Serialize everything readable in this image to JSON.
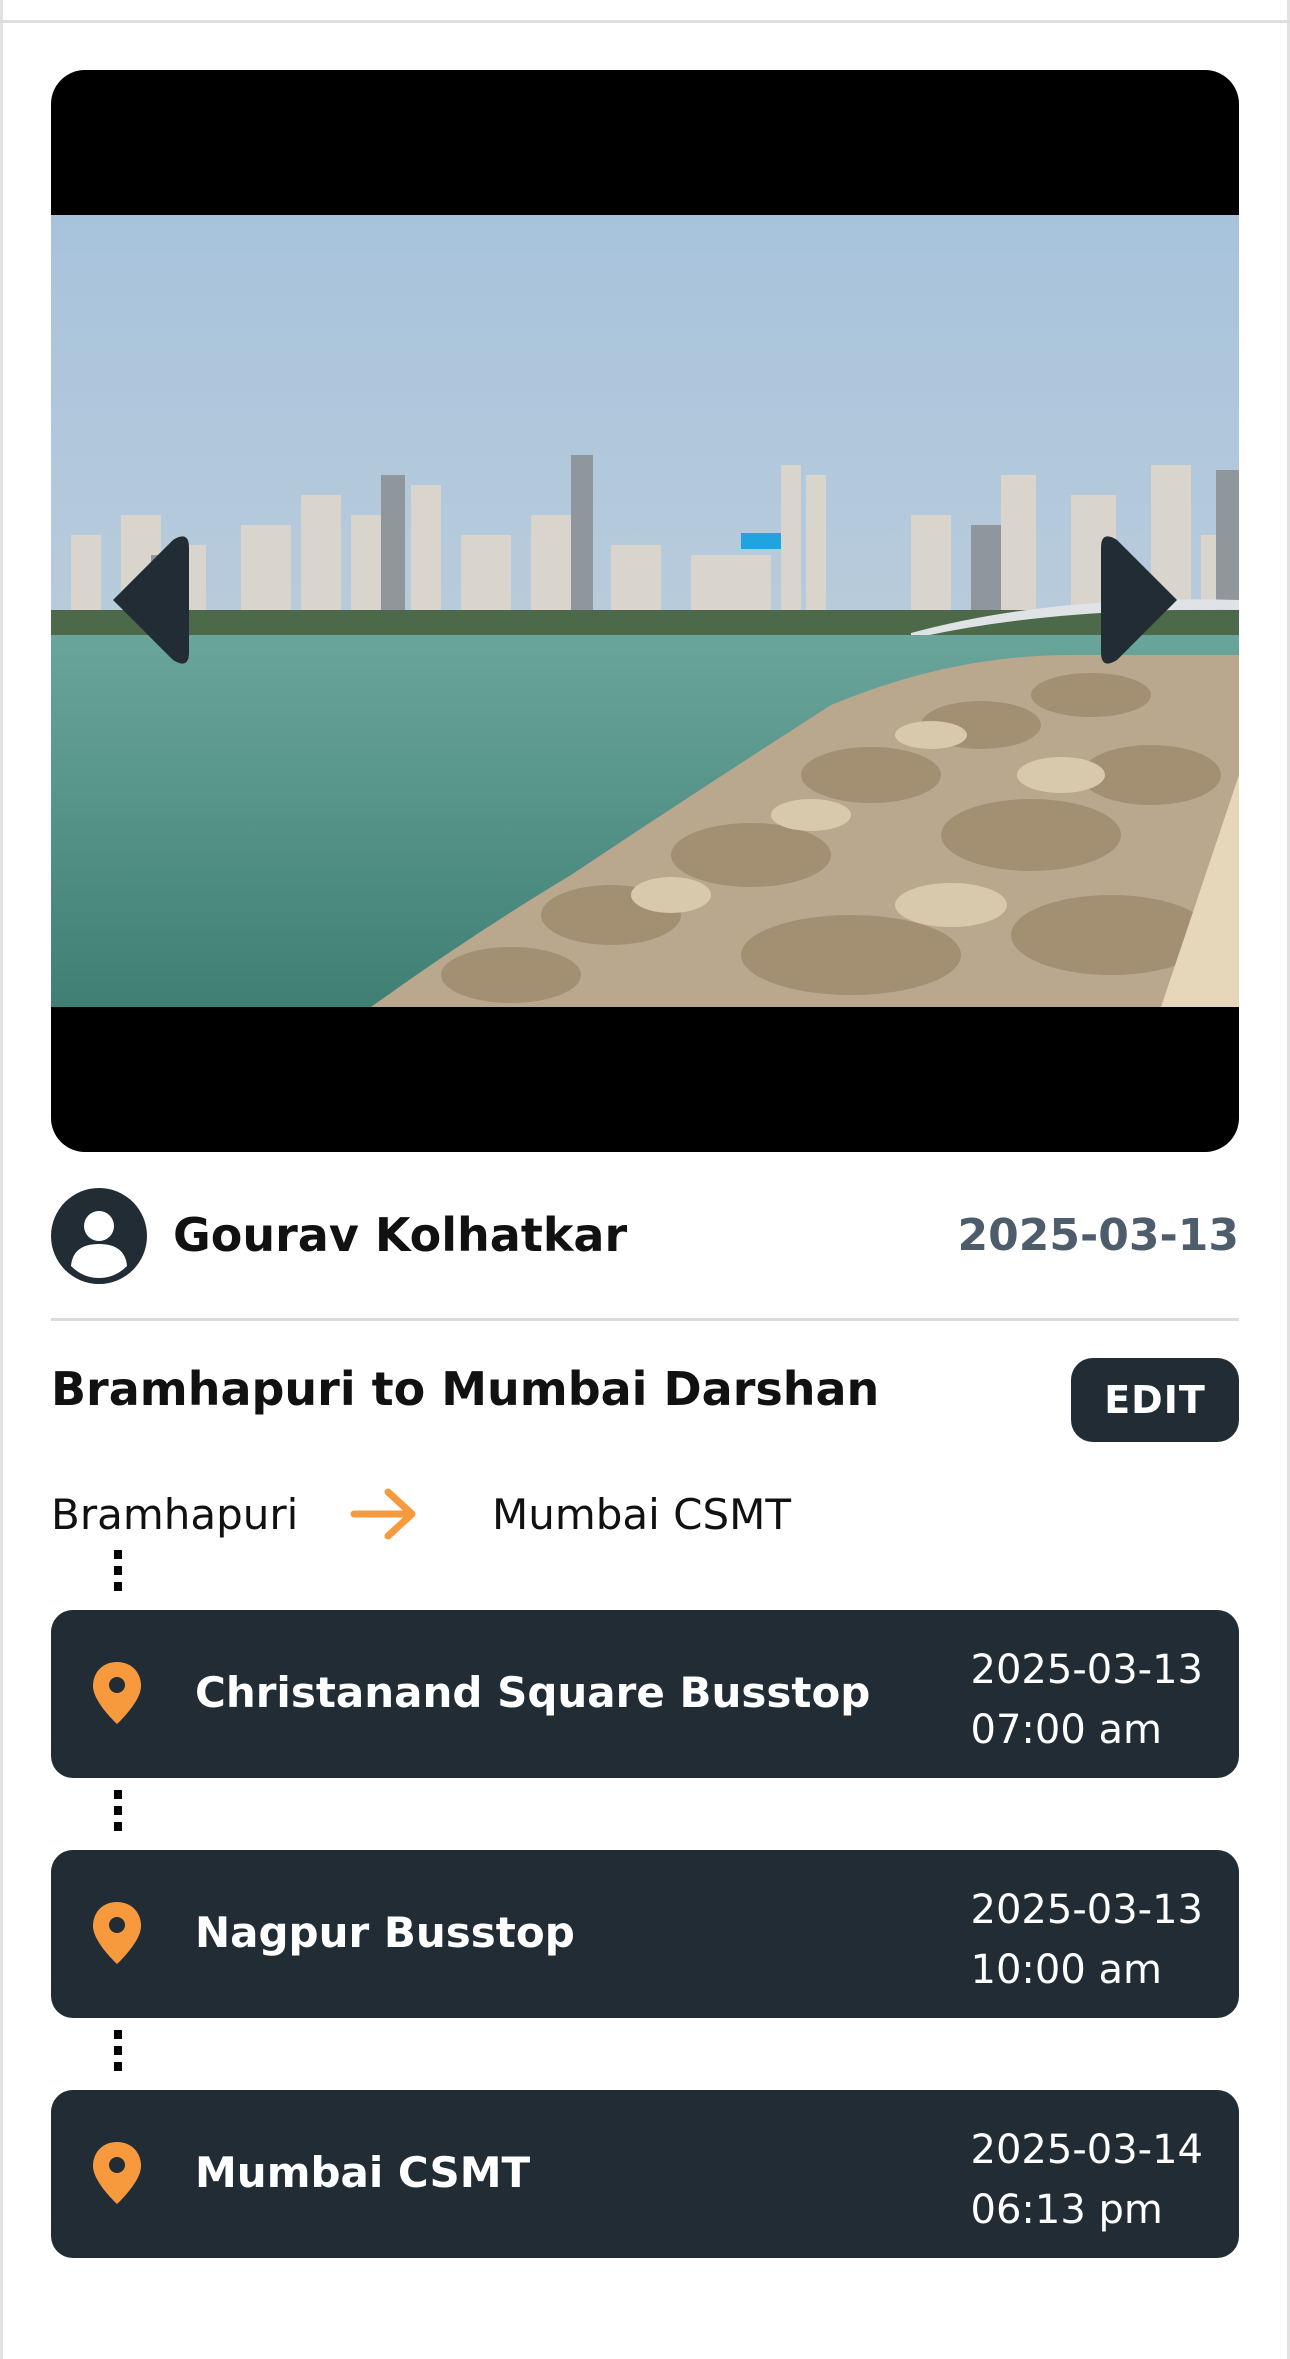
{
  "post": {
    "author": "Gourav Kolhatkar",
    "date": "2025-03-13",
    "title": "Bramhapuri to Mumbai Darshan",
    "edit_label": "EDIT"
  },
  "route": {
    "from": "Bramhapuri",
    "to": "Mumbai CSMT"
  },
  "stops": [
    {
      "name": "Christanand Square Busstop",
      "date": "2025-03-13",
      "time": "07:00 am"
    },
    {
      "name": "Nagpur Busstop",
      "date": "2025-03-13",
      "time": "10:00 am"
    },
    {
      "name": "Mumbai CSMT",
      "date": "2025-03-14",
      "time": "06:13 pm"
    }
  ],
  "colors": {
    "dark": "#222c35",
    "accent": "#f79a3e",
    "date_text": "#4e5d6b"
  },
  "icons": [
    "chevron-left-icon",
    "chevron-right-icon",
    "user-avatar-icon",
    "arrow-right-icon",
    "location-pin-icon"
  ]
}
